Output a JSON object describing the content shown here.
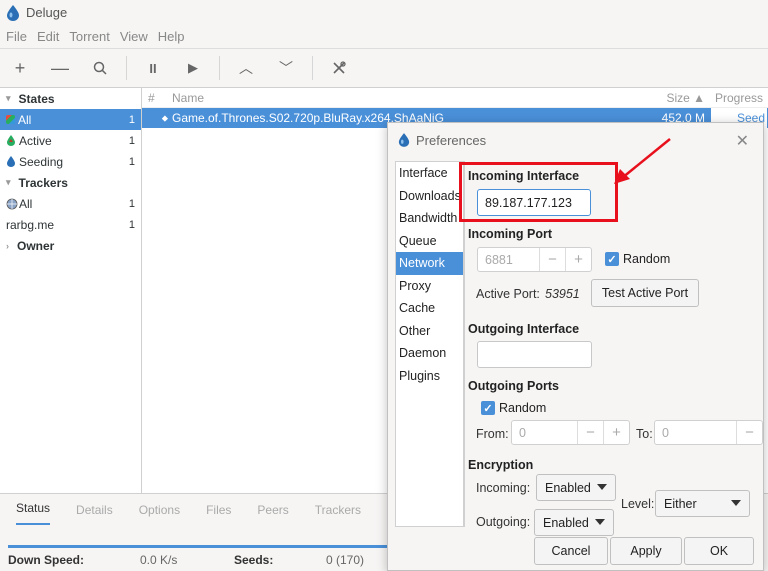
{
  "window": {
    "title": "Deluge"
  },
  "menu": [
    "File",
    "Edit",
    "Torrent",
    "View",
    "Help"
  ],
  "sidebar": {
    "states_header": "States",
    "items_states": [
      {
        "label": "All",
        "count": "1"
      },
      {
        "label": "Active",
        "count": "1"
      },
      {
        "label": "Seeding",
        "count": "1"
      }
    ],
    "trackers_header": "Trackers",
    "items_trackers": [
      {
        "label": "All",
        "count": "1"
      },
      {
        "label": "rarbg.me",
        "count": "1"
      }
    ],
    "owner_header": "Owner"
  },
  "table": {
    "col_hash": "#",
    "col_name": "Name",
    "col_size": "Size ▲",
    "col_progress": "Progress",
    "row": {
      "name": "Game.of.Thrones.S02.720p.BluRay.x264.ShAaNiG",
      "size": "452.0 M",
      "progress": "Seed"
    }
  },
  "bottom_tabs": [
    "Status",
    "Details",
    "Options",
    "Files",
    "Peers",
    "Trackers"
  ],
  "status": {
    "down_speed_label": "Down Speed:",
    "down_speed_value": "0.0 K/s",
    "seeds_label": "Seeds:",
    "seeds_value": "0 (170)"
  },
  "prefs": {
    "title": "Preferences",
    "nav": [
      "Interface",
      "Downloads",
      "Bandwidth",
      "Queue",
      "Network",
      "Proxy",
      "Cache",
      "Other",
      "Daemon",
      "Plugins"
    ],
    "incoming_interface_label": "Incoming Interface",
    "incoming_interface_value": "89.187.177.123",
    "incoming_port_label": "Incoming Port",
    "incoming_port_value": "6881",
    "random_label": "Random",
    "active_port_label": "Active Port:",
    "active_port_value": "53951",
    "test_port_button": "Test Active Port",
    "outgoing_interface_label": "Outgoing Interface",
    "outgoing_interface_value": "",
    "outgoing_ports_label": "Outgoing Ports",
    "outgoing_random_label": "Random",
    "from_label": "From:",
    "from_value": "0",
    "to_label": "To:",
    "to_value": "0",
    "encryption_label": "Encryption",
    "incoming_label": "Incoming:",
    "incoming_value": "Enabled",
    "outgoing_label": "Outgoing:",
    "outgoing_value": "Enabled",
    "level_label": "Level:",
    "level_value": "Either",
    "cancel": "Cancel",
    "apply": "Apply",
    "ok": "OK"
  },
  "colors": {
    "accent": "#4a90d9",
    "highlight_box": "#e8101c"
  }
}
